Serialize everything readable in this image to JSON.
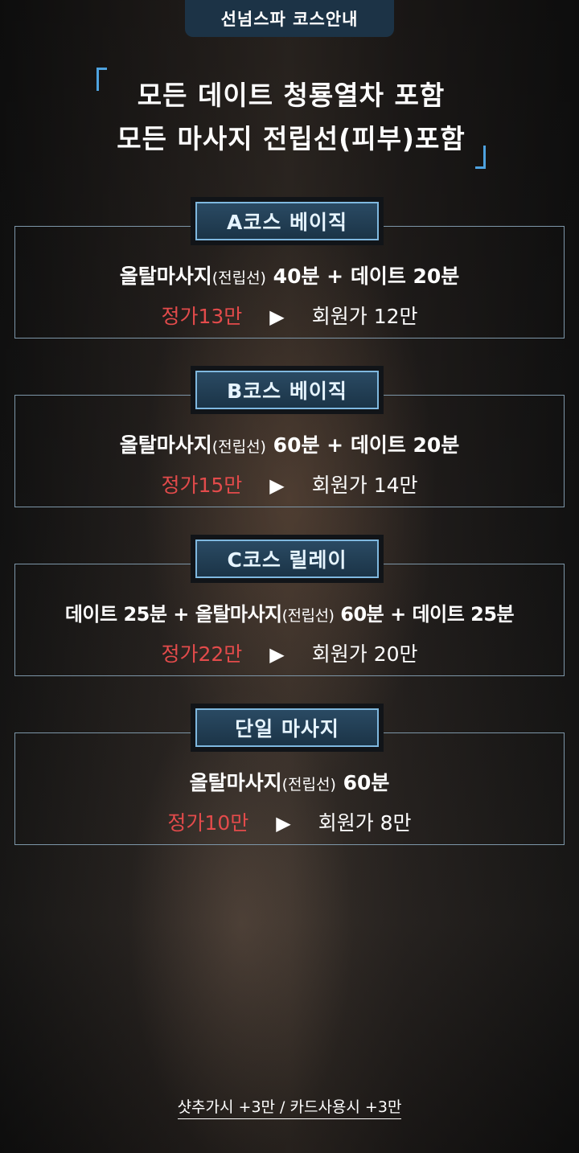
{
  "header": {
    "tab_title": "선넘스파 코스안내"
  },
  "headline": {
    "line1": "모든 데이트 청룡열차 포함",
    "line2": "모든 마사지 전립선(피부)포함"
  },
  "courses": [
    {
      "label": "A코스 베이직",
      "desc_main": "올탈마사지",
      "desc_paren": "(전립선)",
      "desc_rest": " 40분 + 데이트 20분",
      "regular_price": "정가13만",
      "arrow": "▶",
      "member_price": "회원가 12만"
    },
    {
      "label": "B코스 베이직",
      "desc_main": "올탈마사지",
      "desc_paren": "(전립선)",
      "desc_rest": " 60분 + 데이트 20분",
      "regular_price": "정가15만",
      "arrow": "▶",
      "member_price": "회원가 14만"
    },
    {
      "label": "C코스 릴레이",
      "desc_pre": "데이트 25분 + 올탈마사지",
      "desc_paren": "(전립선)",
      "desc_rest": " 60분 + 데이트 25분",
      "regular_price": "정가22만",
      "arrow": "▶",
      "member_price": "회원가 20만"
    },
    {
      "label": "단일 마사지",
      "desc_main": "올탈마사지",
      "desc_paren": "(전립선)",
      "desc_rest": " 60분",
      "regular_price": "정가10만",
      "arrow": "▶",
      "member_price": "회원가 8만"
    }
  ],
  "footer": {
    "note": "샷추가시 +3만 / 카드사용시 +3만"
  },
  "colors": {
    "accent_blue": "#4ea2df",
    "label_bg": "#1b3447",
    "regular_price": "#e34b4b"
  }
}
